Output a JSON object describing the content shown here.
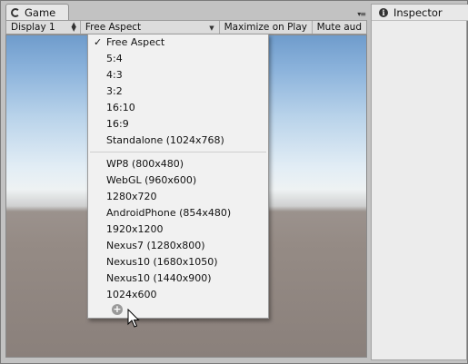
{
  "game_panel": {
    "tab_label": "Game",
    "tab_icon": "game-controller-icon",
    "menu_icon": "panel-menu-icon",
    "toolbar": {
      "display": "Display 1",
      "aspect": "Free Aspect",
      "maximize": "Maximize on Play",
      "mute": "Mute aud"
    }
  },
  "inspector": {
    "tab_label": "Inspector",
    "tab_icon": "info-icon"
  },
  "aspect_menu": {
    "selected": "Free Aspect",
    "group1": [
      "Free Aspect",
      "5:4",
      "4:3",
      "3:2",
      "16:10",
      "16:9",
      "Standalone (1024x768)"
    ],
    "group2": [
      "WP8 (800x480)",
      "WebGL (960x600)",
      "1280x720",
      "AndroidPhone (854x480)",
      "1920x1200",
      "Nexus7 (1280x800)",
      "Nexus10 (1680x1050)",
      "Nexus10 (1440x900)",
      "1024x600"
    ],
    "add_icon": "plus-circle-icon"
  },
  "colors": {
    "panel_bg": "#c2c2c2",
    "menu_bg": "#f1f1f1",
    "sky_top": "#6f9ccc",
    "ground": "#958b85"
  }
}
